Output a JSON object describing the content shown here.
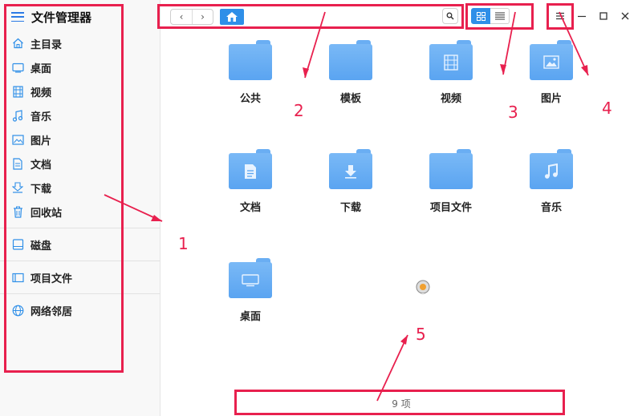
{
  "app": {
    "title": "文件管理器"
  },
  "sidebar": {
    "items": [
      {
        "label": "主目录",
        "icon": "home-icon"
      },
      {
        "label": "桌面",
        "icon": "desktop-icon"
      },
      {
        "label": "视频",
        "icon": "video-icon"
      },
      {
        "label": "音乐",
        "icon": "music-icon"
      },
      {
        "label": "图片",
        "icon": "picture-icon"
      },
      {
        "label": "文档",
        "icon": "document-icon"
      },
      {
        "label": "下载",
        "icon": "download-icon"
      },
      {
        "label": "回收站",
        "icon": "trash-icon"
      },
      {
        "label": "磁盘",
        "icon": "disk-icon"
      },
      {
        "label": "项目文件",
        "icon": "project-icon"
      },
      {
        "label": "网络邻居",
        "icon": "network-icon"
      }
    ]
  },
  "toolbar": {
    "back_glyph": "‹",
    "forward_glyph": "›"
  },
  "files": [
    {
      "name": "公共",
      "icon": "folder-icon"
    },
    {
      "name": "模板",
      "icon": "folder-icon"
    },
    {
      "name": "视频",
      "icon": "video-folder-icon"
    },
    {
      "name": "图片",
      "icon": "picture-folder-icon"
    },
    {
      "name": "文档",
      "icon": "document-folder-icon"
    },
    {
      "name": "下载",
      "icon": "download-folder-icon"
    },
    {
      "name": "项目文件",
      "icon": "folder-icon"
    },
    {
      "name": "音乐",
      "icon": "music-folder-icon"
    },
    {
      "name": "桌面",
      "icon": "desktop-folder-icon"
    }
  ],
  "status": {
    "item_count": "9 项"
  },
  "annotations": {
    "labels": [
      "1",
      "2",
      "3",
      "4",
      "5"
    ],
    "color": "#e8204e"
  },
  "colors": {
    "accent": "#2f8fe8",
    "folder": "#6aaef3",
    "annotation": "#e8204e"
  }
}
